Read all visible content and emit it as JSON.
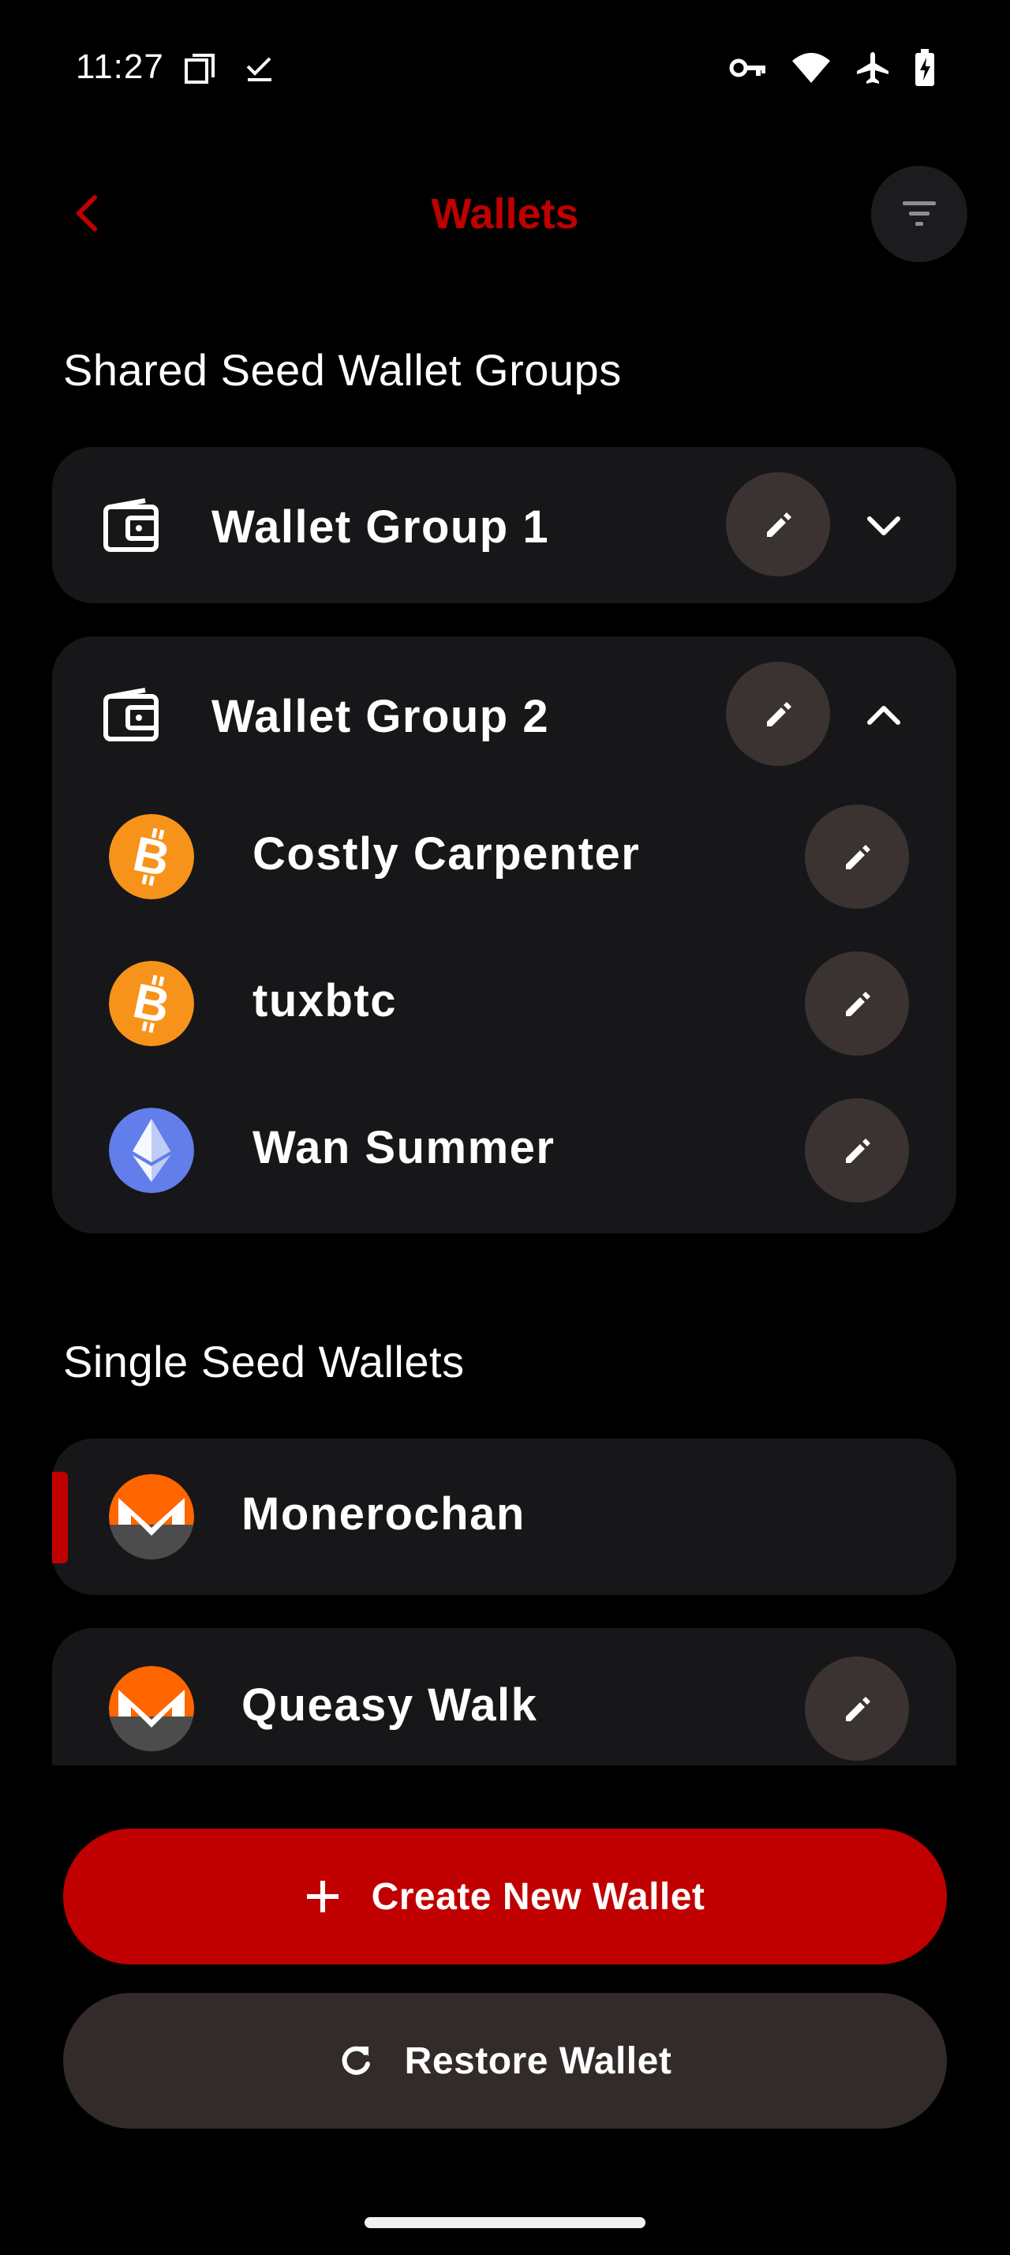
{
  "status_bar": {
    "time": "11:27",
    "icons_left": [
      "screenshot-icon",
      "check-icon"
    ],
    "icons_right": [
      "vpn-key-icon",
      "wifi-icon",
      "airplane-icon",
      "battery-charging-icon"
    ]
  },
  "header": {
    "title": "Wallets",
    "back_icon": "chevron-left-icon",
    "filter_icon": "filter-icon"
  },
  "shared_section": {
    "title": "Shared Seed Wallet Groups",
    "groups": [
      {
        "name": "Wallet Group 1",
        "expanded": false,
        "wallets": []
      },
      {
        "name": "Wallet Group 2",
        "expanded": true,
        "wallets": [
          {
            "name": "Costly Carpenter",
            "coin": "bitcoin"
          },
          {
            "name": "tuxbtc",
            "coin": "bitcoin"
          },
          {
            "name": "Wan Summer",
            "coin": "ethereum"
          }
        ]
      }
    ]
  },
  "single_section": {
    "title": "Single Seed Wallets",
    "wallets": [
      {
        "name": "Monerochan",
        "coin": "monero",
        "active": true
      },
      {
        "name": "Queasy Walk",
        "coin": "monero",
        "active": false
      }
    ]
  },
  "actions": {
    "create_label": "Create New Wallet",
    "restore_label": "Restore Wallet"
  },
  "colors": {
    "accent": "#c00000",
    "card": "#17171a",
    "edit_button": "#3a3331",
    "bitcoin": "#f7931a",
    "ethereum": "#627eea",
    "monero": "#ff6600"
  }
}
